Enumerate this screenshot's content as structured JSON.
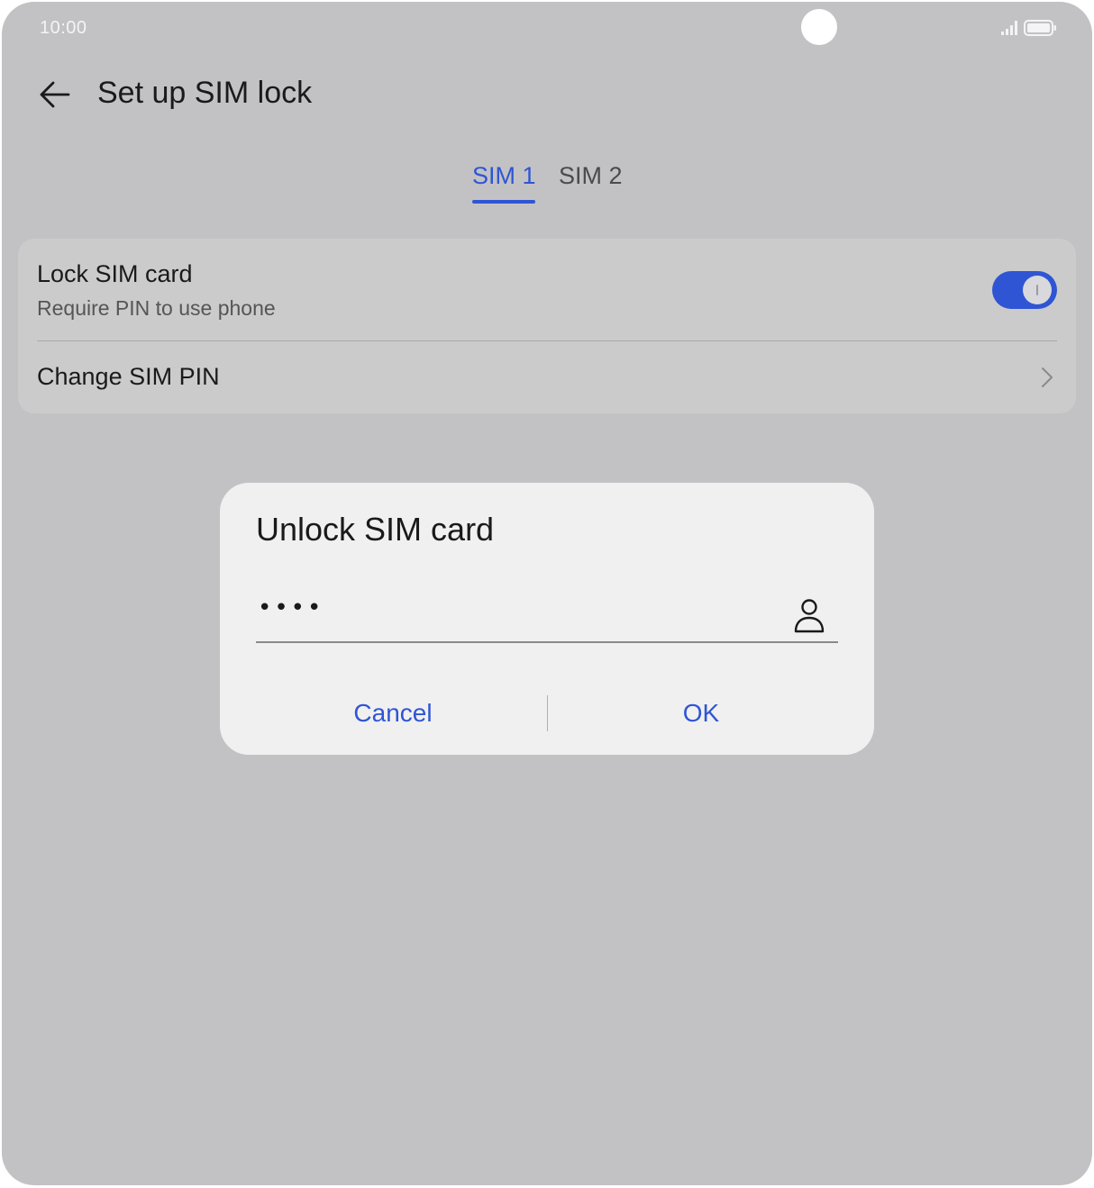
{
  "status_bar": {
    "time": "10:00",
    "icons": [
      "signal-icon",
      "battery-icon"
    ]
  },
  "app_bar": {
    "back_icon": "arrow-left-icon",
    "title": "Set up SIM lock"
  },
  "tabs": [
    {
      "label": "SIM 1",
      "selected": true
    },
    {
      "label": "SIM 2",
      "selected": false
    }
  ],
  "settings": {
    "lock_sim": {
      "title": "Lock SIM card",
      "subtitle": "Require PIN to use phone",
      "enabled": true
    },
    "change_pin": {
      "title": "Change SIM PIN",
      "icon": "chevron-right-icon"
    }
  },
  "dialog": {
    "title": "Unlock SIM card",
    "pin_value": "••••",
    "input_icon": "person-icon",
    "cancel_label": "Cancel",
    "ok_label": "OK"
  },
  "colors": {
    "accent": "#2f55d4",
    "scrim_background": "#c2c2c4",
    "dialog_background": "#f0f0f0"
  }
}
